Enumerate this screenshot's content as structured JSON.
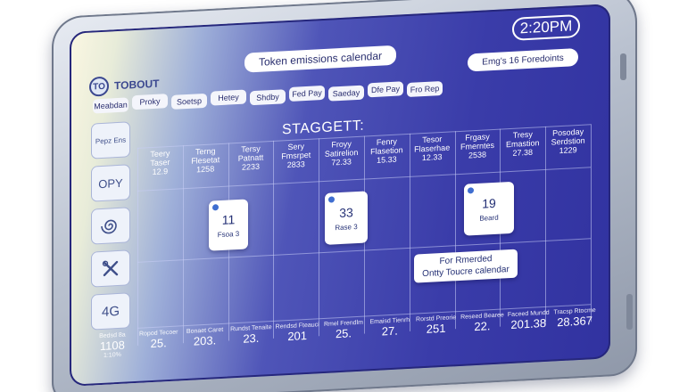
{
  "header": {
    "title": "Token emissions calendar",
    "time": "2:20PM",
    "filter": "Emg's 16 Foredoints",
    "logo": "TOBOUT",
    "logo_mark": "TO"
  },
  "tabs": [
    "Meabdan",
    "Proky",
    "Soetsp",
    "Hetey",
    "Shdby",
    "Fed Pay",
    "Saeday",
    "Dfe Pay",
    "Fro Rep"
  ],
  "sidebar": {
    "items": [
      {
        "label": "Pepz Ens",
        "icon": "calendar-icon"
      },
      {
        "label": "OPY",
        "icon": "copy-icon"
      },
      {
        "label": "",
        "icon": "spiral-icon"
      },
      {
        "label": "",
        "icon": "tools-icon"
      },
      {
        "label": "4G",
        "icon": "network-icon"
      }
    ]
  },
  "main": {
    "title": "STAGGETT:",
    "columns": [
      {
        "title": "Teery\nTaser\n12.9",
        "value": ""
      },
      {
        "title": "Terng\nFlesetat\n1258",
        "value": ""
      },
      {
        "title": "Tersy\nPatnatt\n2233",
        "value": ""
      },
      {
        "title": "Sery\nFmsrpet\n2833",
        "value": ""
      },
      {
        "title": "Froyy\nSatirelion\n72.33",
        "value": ""
      },
      {
        "title": "Fenry\nFlasetion\n15.33",
        "value": ""
      },
      {
        "title": "Tesor\nFlaserhae\n12.33",
        "value": ""
      },
      {
        "title": "Frgasy\nFmerntes\n2538",
        "value": ""
      },
      {
        "title": "Tresy\nEmastion\n27.38",
        "value": ""
      },
      {
        "title": "Posoday\nSerdstion\n1229",
        "value": ""
      }
    ],
    "events": [
      {
        "number": "11",
        "label": "Fsoa 3"
      },
      {
        "number": "33",
        "label": "Rase 3"
      },
      {
        "number": "19",
        "label": "Beard"
      }
    ],
    "note": {
      "line1": "For Rmerded",
      "line2": "Ontty Toucre calendar"
    }
  },
  "footer": [
    {
      "label": "Bedsd 8a",
      "value": "1108",
      "sub": "1:10%"
    },
    {
      "label": "Ropod Tecoer",
      "value": "25.",
      "sub": ""
    },
    {
      "label": "Bonaet Caret",
      "value": "203.",
      "sub": ""
    },
    {
      "label": "Rundst Tenaite",
      "value": "23.",
      "sub": ""
    },
    {
      "label": "Rendsd Fteauci",
      "value": "201",
      "sub": ""
    },
    {
      "label": "Rmel Frendlm",
      "value": "25.",
      "sub": ""
    },
    {
      "label": "Emaisd Tienrh",
      "value": "27.",
      "sub": ""
    },
    {
      "label": "Rorstd Preorie",
      "value": "251",
      "sub": ""
    },
    {
      "label": "Reseed Bearee",
      "value": "22.",
      "sub": ""
    },
    {
      "label": "Faceed Mundd",
      "value": "201.38",
      "sub": ""
    },
    {
      "label": "Tracsp Rtocme",
      "value": "28.367",
      "sub": ""
    }
  ]
}
